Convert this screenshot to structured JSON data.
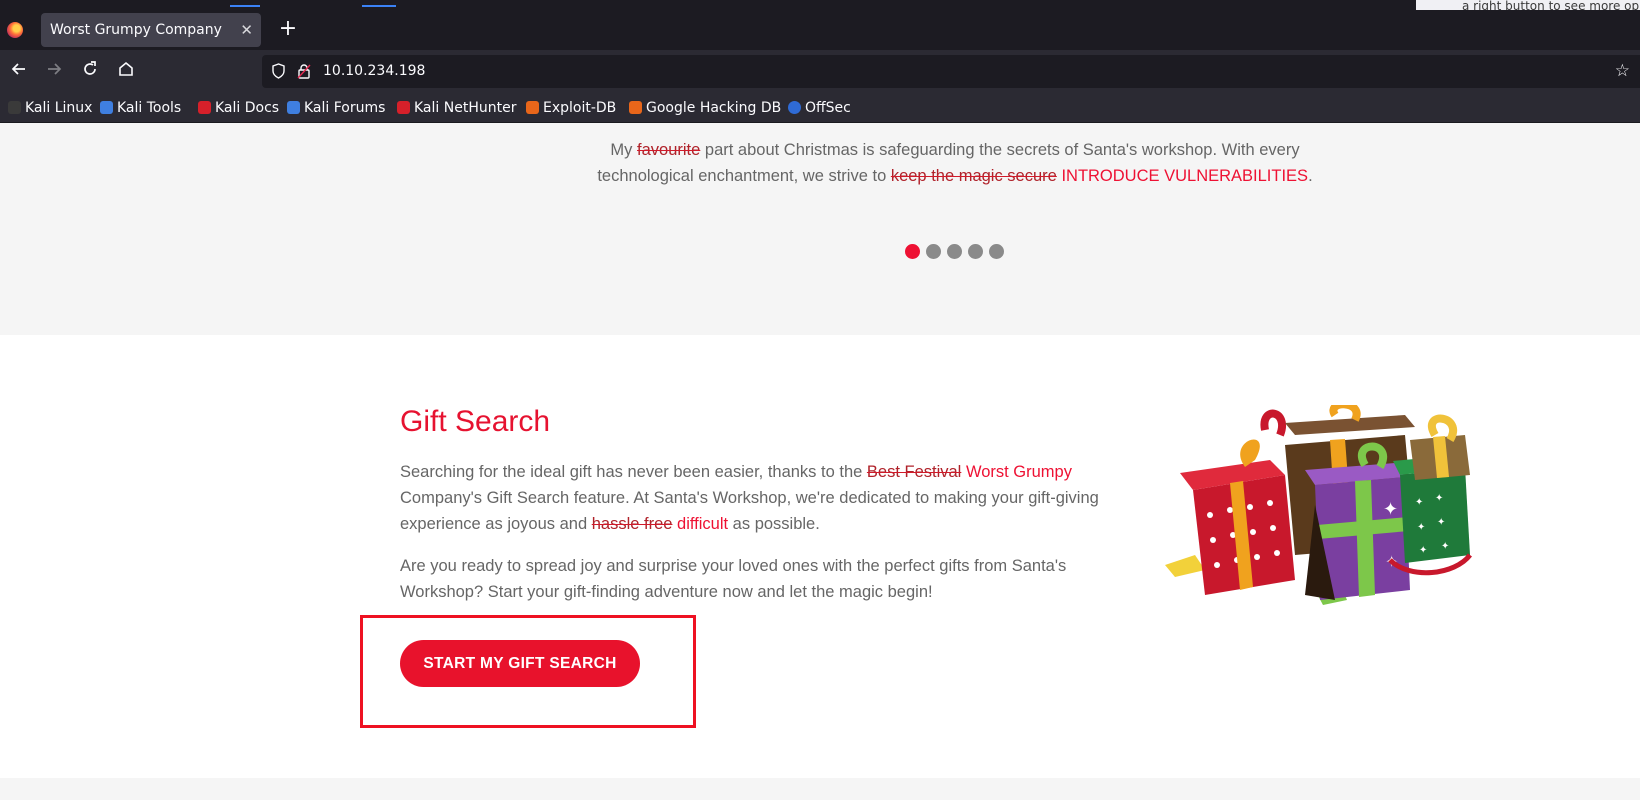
{
  "notice": {
    "text": "a right button to see more op"
  },
  "browser": {
    "tab_title": "Worst Grumpy Company",
    "tab_close": "✕",
    "new_tab": "+",
    "url": "10.10.234.198",
    "bookmarks": [
      {
        "label": "Kali Linux",
        "icon": "kali-dragon-icon",
        "color": "#3a3a3a"
      },
      {
        "label": "Kali Tools",
        "icon": "kali-tools-icon",
        "color": "#3f7fe0"
      },
      {
        "label": "Kali Docs",
        "icon": "kali-docs-icon",
        "color": "#d6202a"
      },
      {
        "label": "Kali Forums",
        "icon": "kali-forums-icon",
        "color": "#3f7fe0"
      },
      {
        "label": "Kali NetHunter",
        "icon": "kali-nethunter-icon",
        "color": "#d6202a"
      },
      {
        "label": "Exploit-DB",
        "icon": "exploit-db-icon",
        "color": "#e8661a"
      },
      {
        "label": "Google Hacking DB",
        "icon": "google-hacking-db-icon",
        "color": "#e8661a"
      },
      {
        "label": "OffSec",
        "icon": "offsec-icon",
        "color": "#2f6bd6"
      }
    ]
  },
  "testimonial": {
    "pre": "My ",
    "strike1": "favourite",
    "mid1": " part about Christmas is safeguarding the secrets of Santa's workshop. With every technological enchantment, we strive to ",
    "strike2": "keep the magic secure",
    "sp": " ",
    "red": "INTRODUCE VULNERABILITIES",
    "end": ".",
    "dots": 5,
    "active_dot": 0
  },
  "gift_search": {
    "title": "Gift Search",
    "p1_pre": "Searching for the ideal gift has never been easier, thanks to the ",
    "p1_strike1": "Best Festival",
    "p1_sp": " ",
    "p1_red1": "Worst Grumpy",
    "p1_mid": " Company's Gift Search feature. At Santa's Workshop, we're dedicated to making your gift-giving experience as joyous and ",
    "p1_strike2": "hassle free",
    "p1_sp2": " ",
    "p1_red2": "difficult",
    "p1_end": " as possible.",
    "p2": "Are you ready to spread joy and surprise your loved ones with the perfect gifts from Santa's Workshop? Start your gift-finding adventure now and let the magic begin!",
    "cta_label": "START MY GIFT SEARCH"
  },
  "colors": {
    "accent": "#e8122c",
    "highlight": "#ee1122"
  }
}
